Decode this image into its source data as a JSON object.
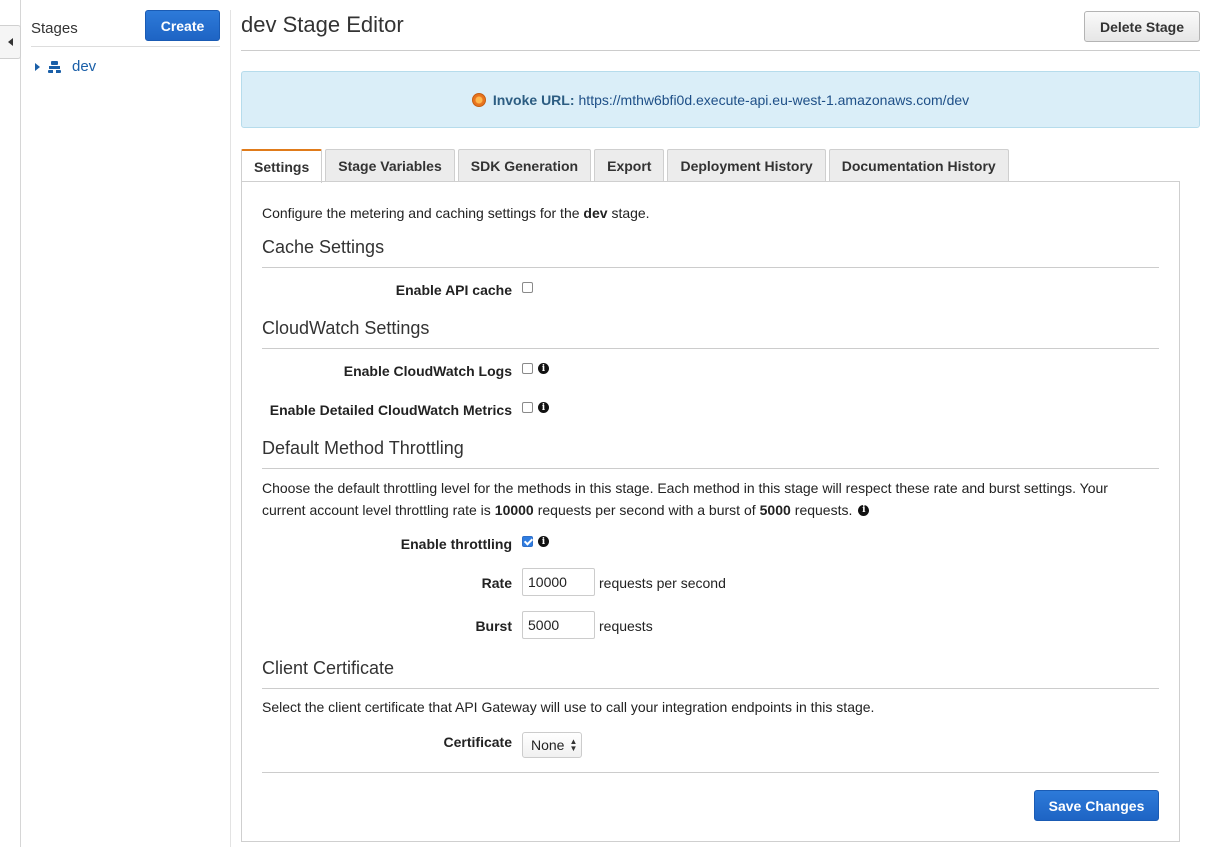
{
  "sidebar": {
    "title": "Stages",
    "create_label": "Create",
    "stage_name": "dev"
  },
  "header": {
    "title": "dev Stage Editor",
    "delete_label": "Delete Stage"
  },
  "invoke": {
    "label": "Invoke URL:",
    "url": "https://mthw6bfi0d.execute-api.eu-west-1.amazonaws.com/dev"
  },
  "tabs": [
    "Settings",
    "Stage Variables",
    "SDK Generation",
    "Export",
    "Deployment History",
    "Documentation History"
  ],
  "settings": {
    "intro_prefix": "Configure the metering and caching settings for the",
    "intro_stage": "dev",
    "intro_suffix": "stage.",
    "cache": {
      "title": "Cache Settings",
      "enable_label": "Enable API cache",
      "enabled": false
    },
    "cloudwatch": {
      "title": "CloudWatch Settings",
      "logs_label": "Enable CloudWatch Logs",
      "logs_enabled": false,
      "metrics_label": "Enable Detailed CloudWatch Metrics",
      "metrics_enabled": false
    },
    "throttling": {
      "title": "Default Method Throttling",
      "desc_line1": "Choose the default throttling level for the methods in this stage. Each method in this stage will respect these rate and burst settings. Your",
      "desc_line2_prefix": "current account level throttling rate is",
      "account_rate": "10000",
      "desc_line2_mid": "requests per second with a burst of",
      "account_burst": "5000",
      "desc_line2_suffix": "requests.",
      "enable_label": "Enable throttling",
      "enabled": true,
      "rate_label": "Rate",
      "rate_value": "10000",
      "rate_unit": "requests per second",
      "burst_label": "Burst",
      "burst_value": "5000",
      "burst_unit": "requests"
    },
    "certificate": {
      "title": "Client Certificate",
      "desc": "Select the client certificate that API Gateway will use to call your integration endpoints in this stage.",
      "label": "Certificate",
      "selected": "None"
    },
    "save_label": "Save Changes"
  },
  "colors": {
    "primary_button": "#1e64c4",
    "banner_bg": "#daeef8",
    "active_tab_accent": "#e07b1a",
    "link": "#1a5fa8"
  }
}
